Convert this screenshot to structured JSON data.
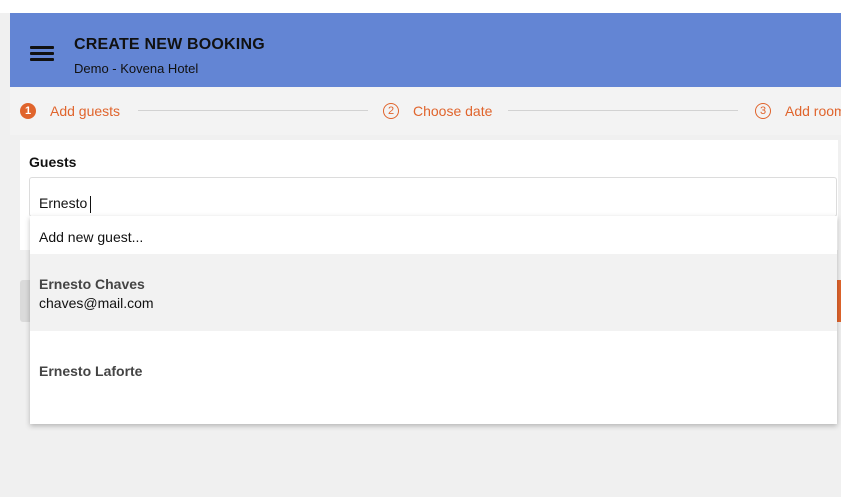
{
  "header": {
    "title": "CREATE NEW BOOKING",
    "subtitle": "Demo - Kovena Hotel"
  },
  "stepper": {
    "steps": [
      {
        "number": "1",
        "label": "Add guests",
        "active": true
      },
      {
        "number": "2",
        "label": "Choose date",
        "active": false
      },
      {
        "number": "3",
        "label": "Add room",
        "active": false
      }
    ]
  },
  "guests": {
    "label": "Guests",
    "input_value": "Ernesto"
  },
  "dropdown": {
    "add_new": "Add new guest...",
    "results": [
      {
        "name": "Ernesto Chaves",
        "email": "chaves@mail.com"
      },
      {
        "name": "Ernesto Laforte"
      }
    ]
  },
  "colors": {
    "header_bg": "#6385d4",
    "accent": "#e0642c",
    "page_bg": "#f0f0f0"
  },
  "icons": {
    "menu": "menu-icon"
  }
}
